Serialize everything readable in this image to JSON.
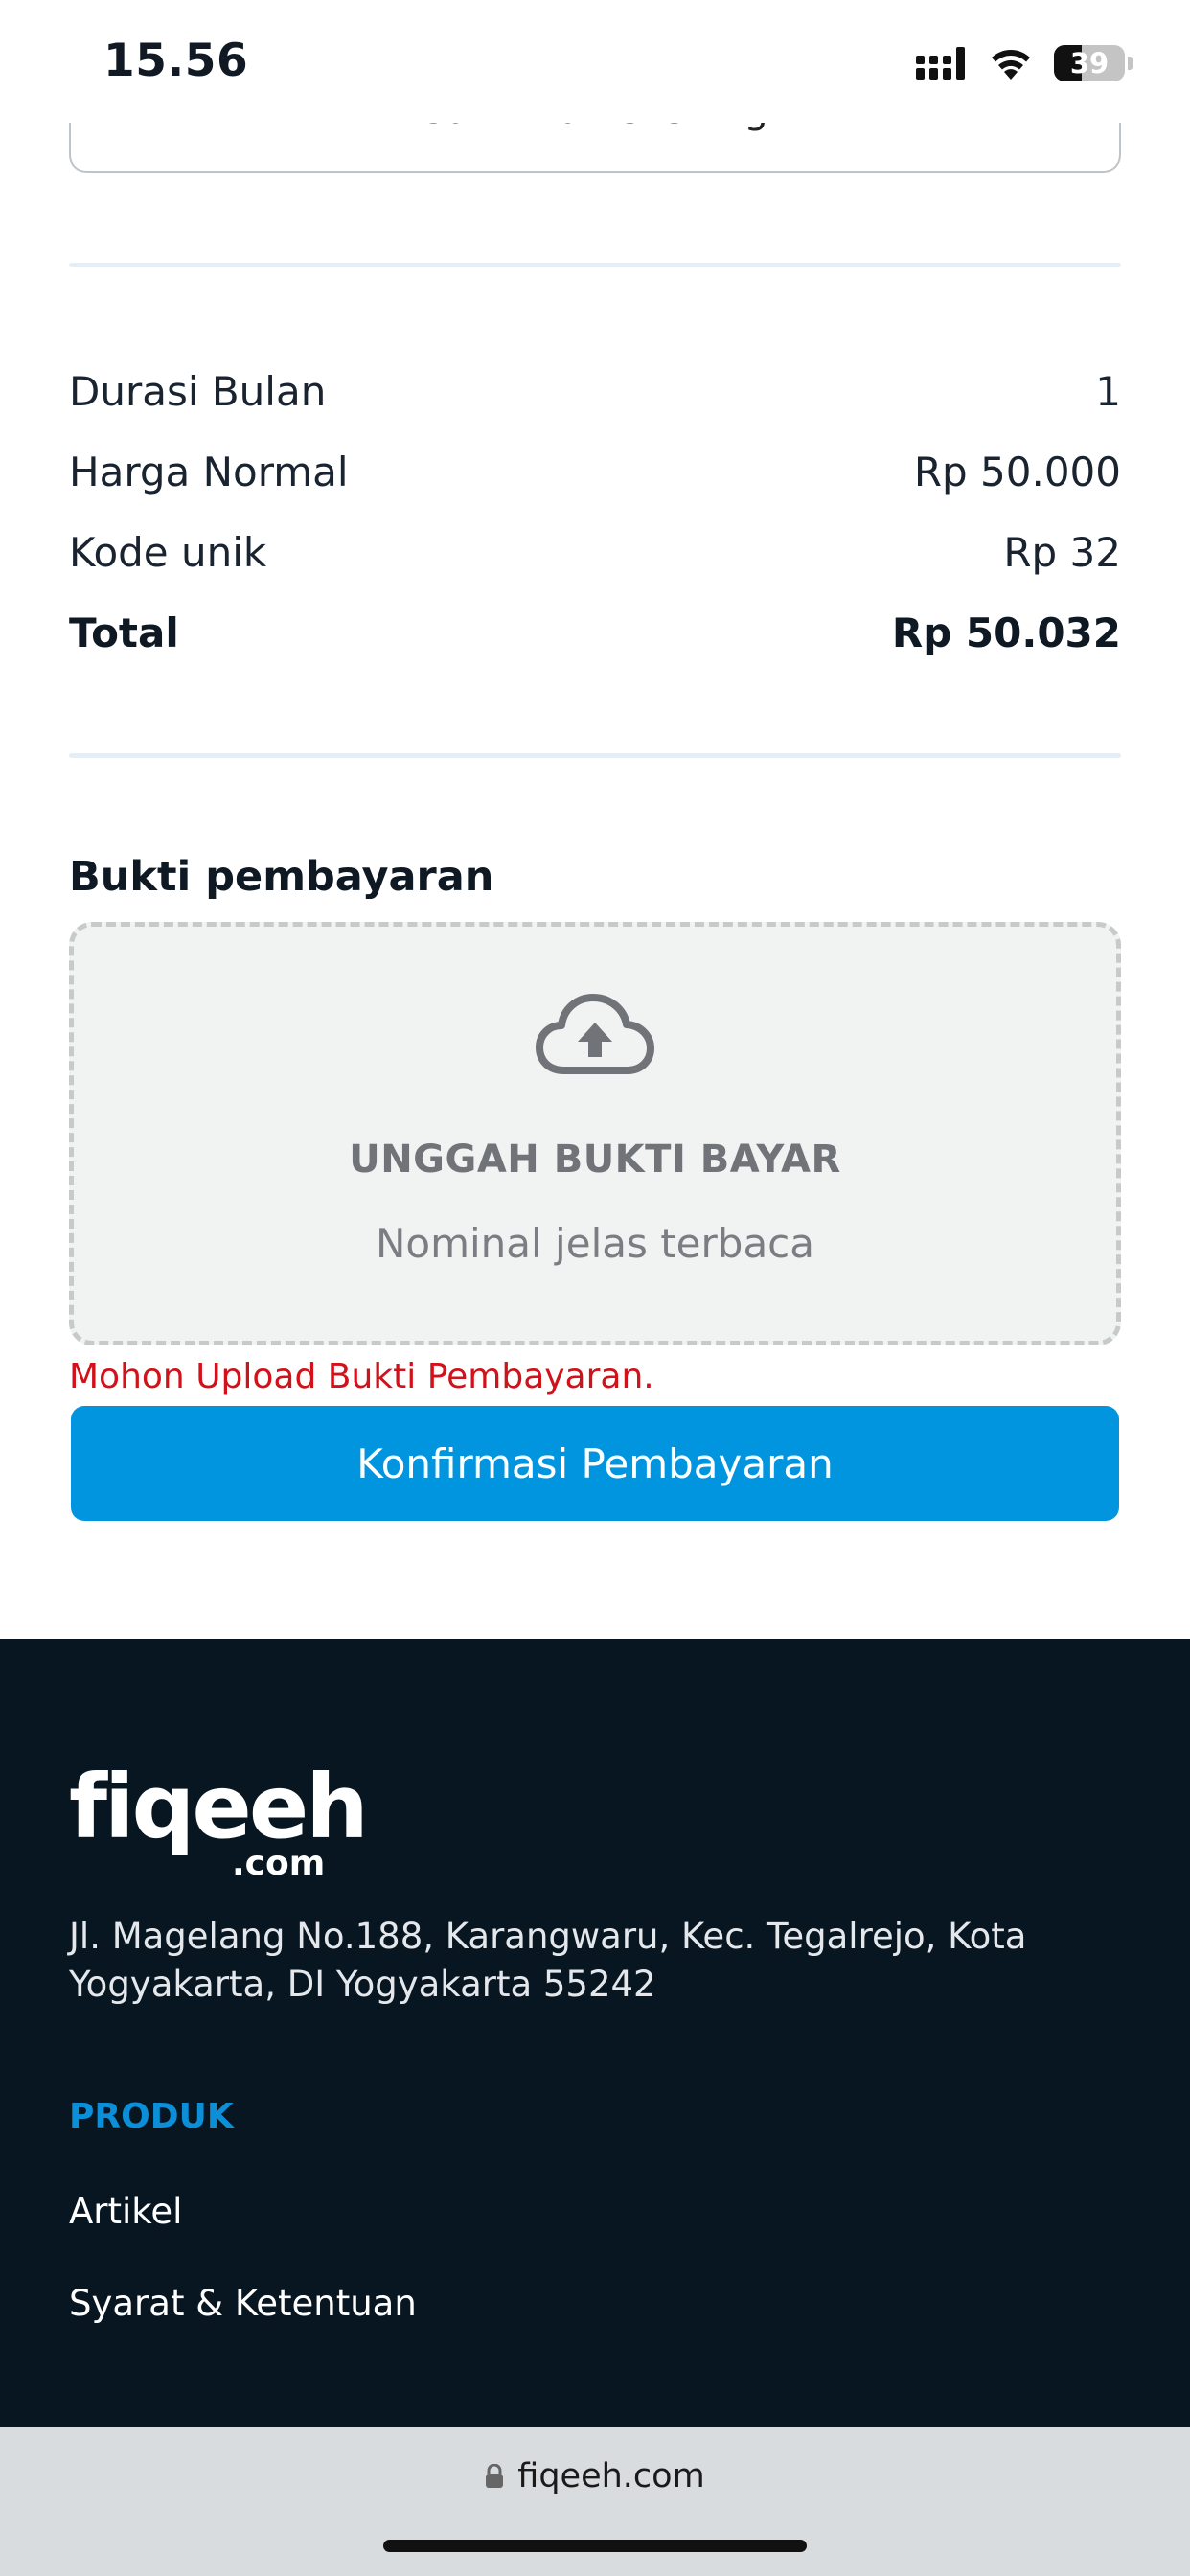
{
  "status_bar": {
    "time": "15.56",
    "battery": "39"
  },
  "top_button": {
    "label": "Salin No Rekening"
  },
  "summary": {
    "rows": [
      {
        "label": "Durasi Bulan",
        "value": "1"
      },
      {
        "label": "Harga Normal",
        "value": "Rp 50.000"
      },
      {
        "label": "Kode unik",
        "value": "Rp 32"
      }
    ],
    "total": {
      "label": "Total",
      "value": "Rp 50.032"
    }
  },
  "upload": {
    "section_title": "Bukti pembayaran",
    "title": "UNGGAH BUKTI BAYAR",
    "subtitle": "Nominal jelas terbaca",
    "icon": "cloud-upload-icon",
    "error": "Mohon Upload Bukti Pembayaran."
  },
  "confirm_button": {
    "label": "Konfirmasi Pembayaran",
    "color": "#0295df"
  },
  "footer": {
    "logo_main": "fiqeeh",
    "logo_sub": ".com",
    "address": "Jl. Magelang No.188, Karangwaru, Kec. Tegalrejo, Kota Yogyakarta, DI Yogyakarta 55242",
    "heading": "PRODUK",
    "links": [
      "Artikel",
      "Syarat & Ketentuan"
    ],
    "background": "#071620",
    "heading_color": "#0a8fd8"
  },
  "browser": {
    "url": "fiqeeh.com"
  }
}
